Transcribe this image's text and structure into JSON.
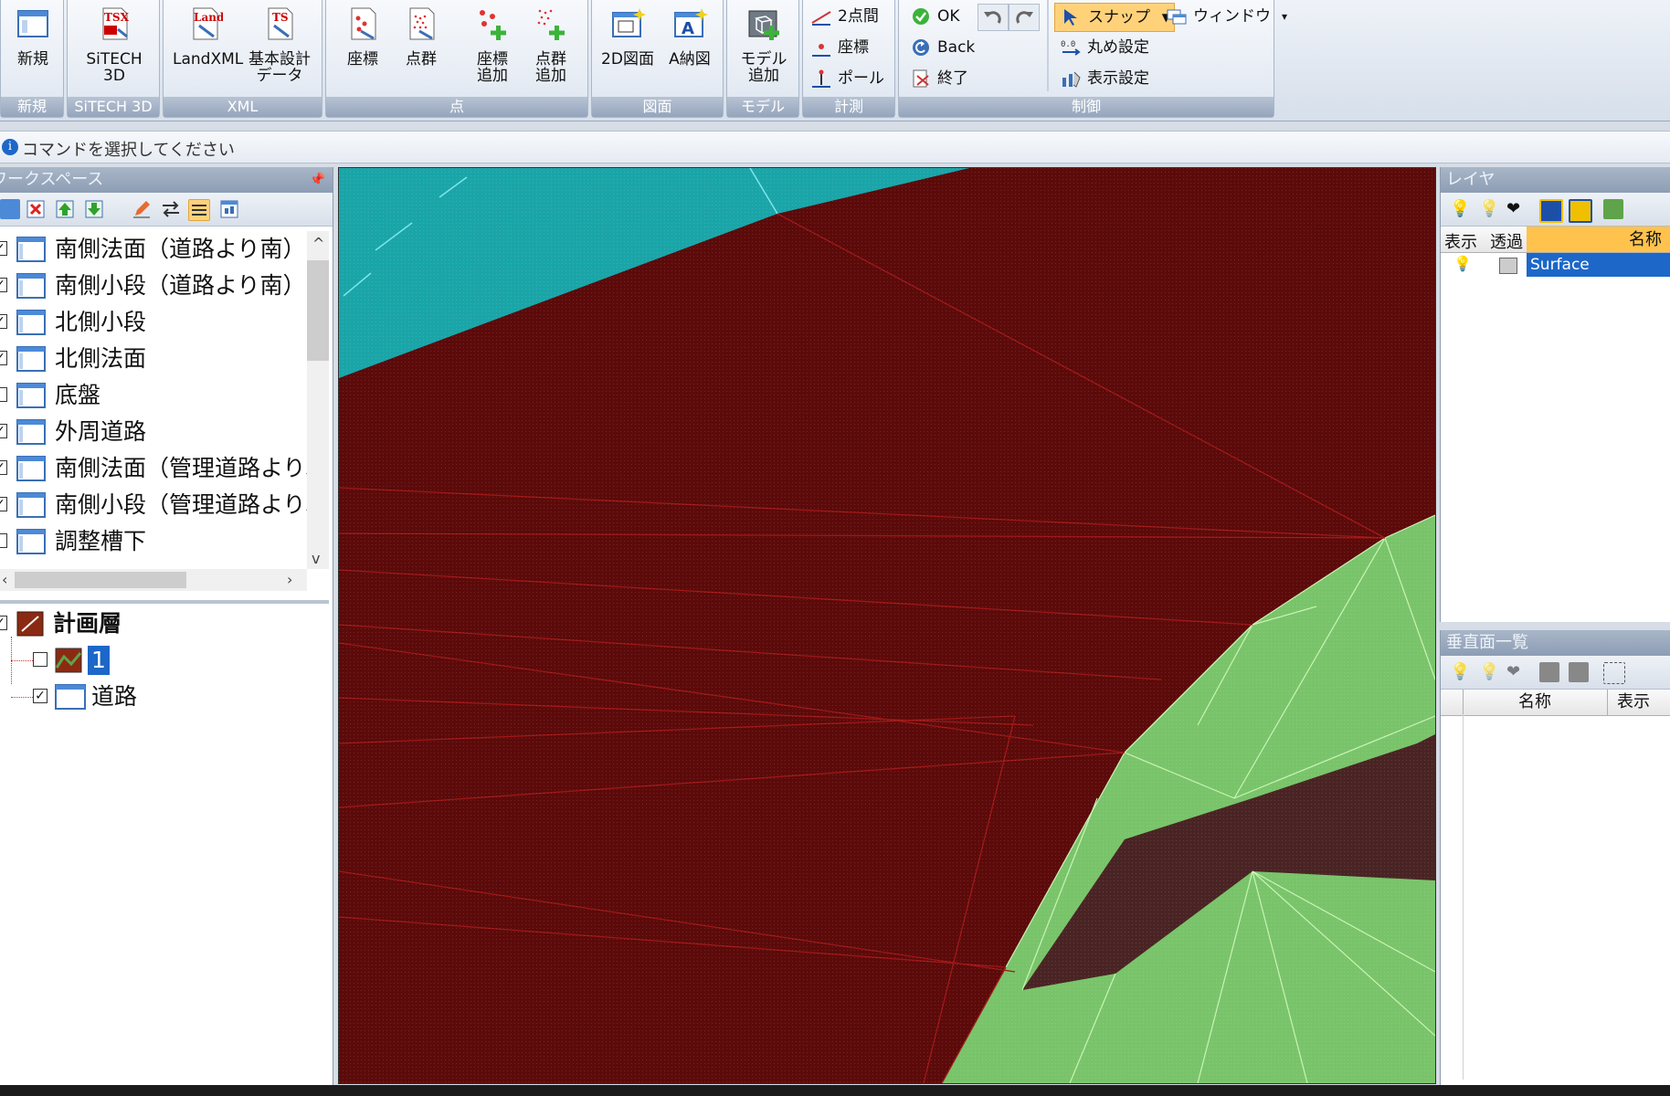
{
  "ribbon": {
    "groups": {
      "new": "新規",
      "sitech": "SiTECH 3D",
      "xml": "XML",
      "point": "点",
      "drawing": "図面",
      "model": "モデル",
      "measure": "計測",
      "control": "制御"
    },
    "buttons": {
      "new": "新規",
      "sitech3d_line1": "SiTECH",
      "sitech3d_line2": "3D",
      "landxml": "LandXML",
      "basic_design_line1": "基本設計",
      "basic_design_line2": "データ",
      "coord": "座標",
      "pointcloud": "点群",
      "coord_add_line1": "座標",
      "coord_add_line2": "追加",
      "pointcloud_add_line1": "点群",
      "pointcloud_add_line2": "追加",
      "drawing2d": "2D図面",
      "drawing_a": "A納図",
      "model_add_line1": "モデル",
      "model_add_line2": "追加",
      "two_point": "2点間",
      "measure_coord": "座標",
      "pole": "ポール",
      "ok": "OK",
      "back": "Back",
      "exit": "終了",
      "snap": "スナップ",
      "window": "ウィンドウ",
      "rounding": "丸め設定",
      "display_settings": "表示設定"
    },
    "colors": {
      "ribbon_bg": "#dfe6f0",
      "snap_highlight": "#ffd27a"
    }
  },
  "status": {
    "message": "コマンドを選択してください"
  },
  "workspace": {
    "title": "ワークスペース",
    "items": [
      {
        "label": "南側法面（道路より南）",
        "checked": true
      },
      {
        "label": "南側小段（道路より南）",
        "checked": true
      },
      {
        "label": "北側小段",
        "checked": true
      },
      {
        "label": "北側法面",
        "checked": true
      },
      {
        "label": "底盤",
        "checked": false
      },
      {
        "label": "外周道路",
        "checked": true
      },
      {
        "label": "南側法面（管理道路より北）",
        "checked": true
      },
      {
        "label": "南側小段（管理道路より北）",
        "checked": true
      },
      {
        "label": "調整槽下",
        "checked": false
      }
    ],
    "plan_layer": {
      "label": "計画層",
      "checked": true
    },
    "sub_items": [
      {
        "label": "1",
        "checked": false
      },
      {
        "label": "道路",
        "checked": true
      }
    ]
  },
  "layer_panel": {
    "title": "レイヤ",
    "columns": {
      "display": "表示",
      "transparency": "透過",
      "name": "名称"
    },
    "rows": [
      {
        "name": "Surface"
      }
    ]
  },
  "vertical_panel": {
    "title": "垂直面一覧",
    "columns": {
      "name": "名称",
      "display": "表示"
    }
  },
  "viewport": {
    "colors": {
      "surface_red": "#5c0a0a",
      "cyan": "#1aa5a8",
      "green": "#79c46a",
      "edge_red": "#a01818",
      "brown": "#6b2a2a"
    }
  }
}
